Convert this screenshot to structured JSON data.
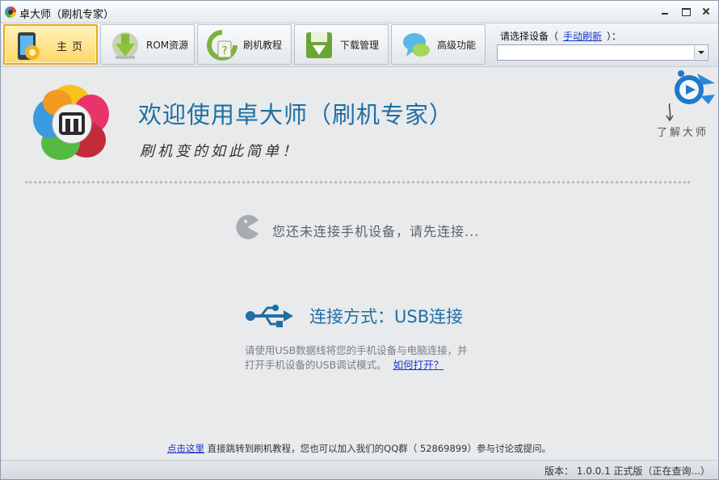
{
  "window": {
    "title": "卓大师（刷机专家）"
  },
  "toolbar": {
    "tabs": [
      {
        "label": "主页",
        "icon": "home-phone-icon",
        "active": true
      },
      {
        "label": "ROM资源",
        "icon": "rom-download-icon",
        "active": false
      },
      {
        "label": "刷机教程",
        "icon": "tutorial-icon",
        "active": false
      },
      {
        "label": "下载管理",
        "icon": "download-manager-icon",
        "active": false
      },
      {
        "label": "高级功能",
        "icon": "advanced-chat-icon",
        "active": false
      }
    ],
    "device_prompt": "请选择设备（",
    "refresh_link": "手动刷新",
    "device_prompt_end": "）：",
    "device_selected": ""
  },
  "main": {
    "welcome_title": "欢迎使用卓大师（刷机专家）",
    "slogan": "刷机变的如此简单！",
    "learn_master": "了解大师",
    "no_device_text": "您还未连接手机设备，请先连接...",
    "connection_mode": "连接方式：USB连接",
    "hint_line1": "请使用USB数据线将您的手机设备与电脑连接，并",
    "hint_line2": "打开手机设备的USB调试模式。",
    "how_to_open": "如何打开？"
  },
  "footer": {
    "click_here": "点击这里",
    "note": " 直接跳转到刷机教程，您也可以加入我们的QQ群（ 52869899）参与讨论或提问。"
  },
  "status": {
    "version": "版本：  1.0.0.1 正式版（正在查询...）"
  },
  "colors": {
    "accent_blue": "#1f6fa3",
    "active_tab": "#ffd76a",
    "link": "#1a38c8"
  }
}
